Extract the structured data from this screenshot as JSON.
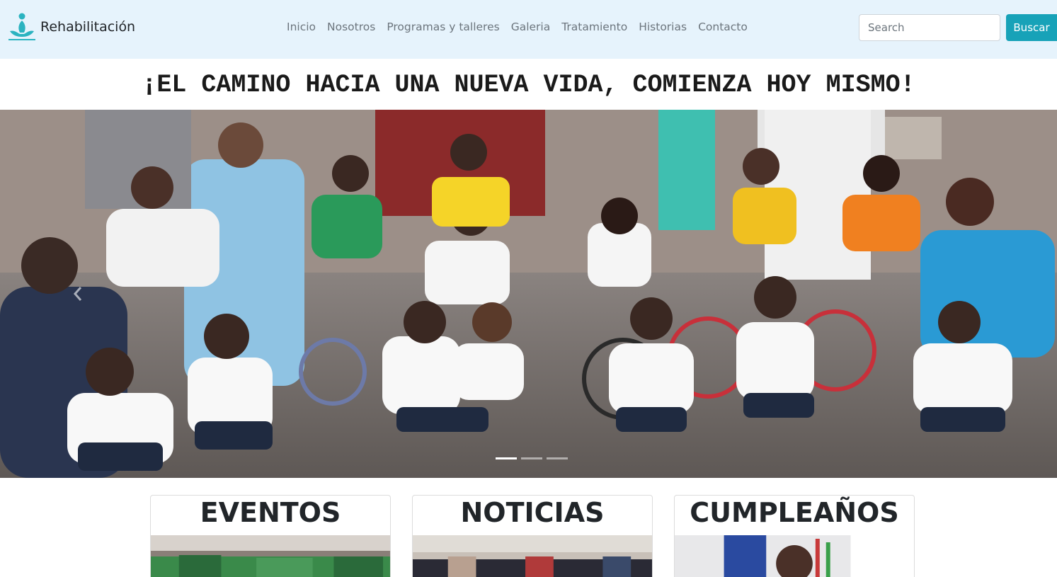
{
  "brand": {
    "name": "Rehabilitación",
    "logo_icon": "person-meditation-icon",
    "accent": "#17a2b8"
  },
  "nav": {
    "items": [
      "Inicio",
      "Nosotros",
      "Programas y talleres",
      "Galeria",
      "Tratamiento",
      "Historias",
      "Contacto"
    ]
  },
  "search": {
    "placeholder": "Search",
    "button_label": "Buscar"
  },
  "headline": "¡EL CAMINO HACIA UNA NUEVA VIDA, COMIENZA HOY MISMO!",
  "carousel": {
    "slide_count": 3,
    "active_slide": 1,
    "prev_icon": "chevron-left-icon"
  },
  "cards": [
    {
      "title": "EVENTOS"
    },
    {
      "title": "NOTICIAS"
    },
    {
      "title": "CUMPLEAÑOS"
    }
  ],
  "colors": {
    "navbar_bg": "#e6f3fc",
    "button_bg": "#17a2b8",
    "link": "#6c757d",
    "text": "#212529"
  }
}
